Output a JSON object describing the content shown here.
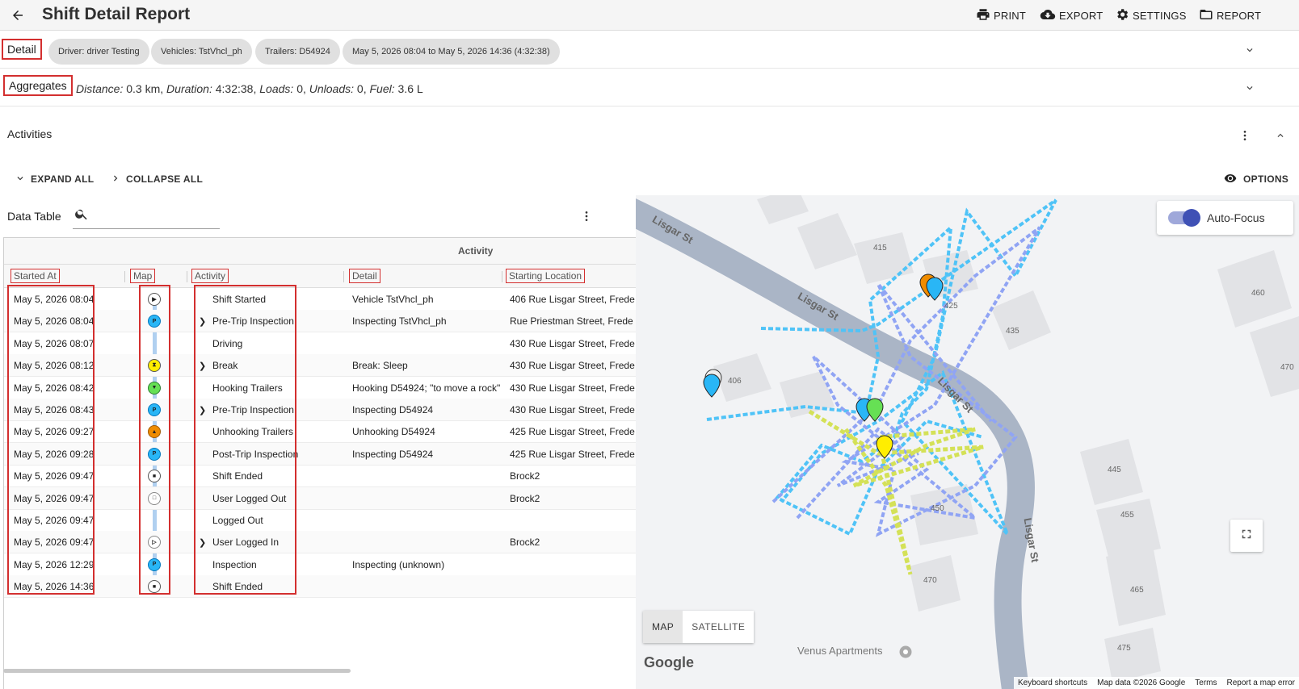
{
  "header": {
    "title": "Shift Detail Report",
    "print_label": "PRINT",
    "export_label": "EXPORT",
    "settings_label": "SETTINGS",
    "report_label": "REPORT"
  },
  "detail": {
    "label": "Detail",
    "chips": [
      "Driver: driver Testing",
      "Vehicles: TstVhcl_ph",
      "Trailers: D54924",
      "May 5, 2026 08:04 to May 5, 2026 14:36 (4:32:38)"
    ]
  },
  "aggregates": {
    "label": "Aggregates",
    "distance_label": "Distance:",
    "distance": "0.3 km",
    "duration_label": "Duration:",
    "duration": "4:32:38",
    "loads_label": "Loads:",
    "loads": "0",
    "unloads_label": "Unloads:",
    "unloads": "0",
    "fuel_label": "Fuel:",
    "fuel": "3.6 L"
  },
  "activities": {
    "title": "Activities",
    "expand_all": "EXPAND ALL",
    "collapse_all": "COLLAPSE ALL",
    "options": "OPTIONS"
  },
  "table": {
    "label": "Data Table",
    "group_header": "Activity",
    "columns": [
      "Started At",
      "Map",
      "Activity",
      "Detail",
      "Starting Location"
    ],
    "rows": [
      {
        "start": "May 5, 2026 08:04",
        "activity": "Shift Started",
        "detail": "Vehicle TstVhcl_ph",
        "location": "406 Rue Lisgar Street, Frede",
        "marker": "play-icon",
        "expandable": false
      },
      {
        "start": "May 5, 2026 08:04",
        "activity": "Pre-Trip Inspection",
        "detail": "Inspecting TstVhcl_ph",
        "location": "Rue Priestman Street, Frede",
        "marker": "inspection-icon",
        "expandable": true
      },
      {
        "start": "May 5, 2026 08:07",
        "activity": "Driving",
        "detail": "",
        "location": "430 Rue Lisgar Street, Frede",
        "marker": "",
        "expandable": false
      },
      {
        "start": "May 5, 2026 08:12",
        "activity": "Break",
        "detail": "Break: Sleep",
        "location": "430 Rue Lisgar Street, Frede",
        "marker": "break-icon",
        "expandable": true
      },
      {
        "start": "May 5, 2026 08:42",
        "activity": "Hooking Trailers",
        "detail": "Hooking D54924; \"to move a rock\"",
        "location": "430 Rue Lisgar Street, Frede",
        "marker": "hook-icon",
        "expandable": false
      },
      {
        "start": "May 5, 2026 08:43",
        "activity": "Pre-Trip Inspection",
        "detail": "Inspecting D54924",
        "location": "430 Rue Lisgar Street, Frede",
        "marker": "inspection-icon",
        "expandable": true
      },
      {
        "start": "May 5, 2026 09:27",
        "activity": "Unhooking Trailers",
        "detail": "Unhooking D54924",
        "location": "425 Rue Lisgar Street, Frede",
        "marker": "unhook-icon",
        "expandable": false
      },
      {
        "start": "May 5, 2026 09:28",
        "activity": "Post-Trip Inspection",
        "detail": "Inspecting D54924",
        "location": "425 Rue Lisgar Street, Frede",
        "marker": "inspection-icon",
        "expandable": false
      },
      {
        "start": "May 5, 2026 09:47",
        "activity": "Shift Ended",
        "detail": "",
        "location": "Brock2",
        "marker": "stop-icon",
        "expandable": false
      },
      {
        "start": "May 5, 2026 09:47",
        "activity": "User Logged Out",
        "detail": "",
        "location": "Brock2",
        "marker": "logout-icon",
        "expandable": false
      },
      {
        "start": "May 5, 2026 09:47",
        "activity": "Logged Out",
        "detail": "",
        "location": "",
        "marker": "",
        "expandable": false
      },
      {
        "start": "May 5, 2026 09:47",
        "activity": "User Logged In",
        "detail": "",
        "location": "Brock2",
        "marker": "login-icon",
        "expandable": true
      },
      {
        "start": "May 5, 2026 12:29",
        "activity": "Inspection",
        "detail": "Inspecting (unknown)",
        "location": "",
        "marker": "inspection-icon",
        "expandable": false
      },
      {
        "start": "May 5, 2026 14:36",
        "activity": "Shift Ended",
        "detail": "",
        "location": "",
        "marker": "stop-icon",
        "expandable": false
      }
    ]
  },
  "map": {
    "auto_focus_label": "Auto-Focus",
    "auto_focus_on": true,
    "map_btn": "MAP",
    "satellite_btn": "SATELLITE",
    "google": "Google",
    "poi": "Venus Apartments",
    "streets": [
      "Lisgar St",
      "Lisgar St",
      "Lisgar St",
      "Lisgar St"
    ],
    "building_numbers": [
      "415",
      "425",
      "435",
      "406",
      "460",
      "470",
      "445",
      "455",
      "450",
      "470",
      "465",
      "475"
    ],
    "footer": [
      "Keyboard shortcuts",
      "Map data ©2026 Google",
      "Terms",
      "Report a map error"
    ]
  },
  "colors": {
    "highlight_border": "#d32f2f",
    "route_blue": "#4fc3f7",
    "route_periwinkle": "#90a4f4",
    "route_yellow": "#d4e157",
    "toggle_on": "#3f51b5"
  }
}
